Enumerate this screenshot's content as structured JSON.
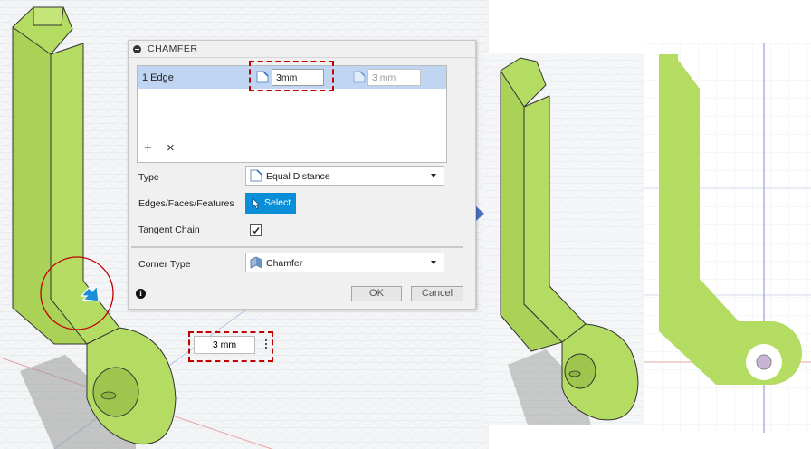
{
  "dialog": {
    "title": "CHAMFER",
    "selection_row": {
      "label": "1 Edge",
      "distance_value": "3mm",
      "second_distance_placeholder": "3 mm"
    },
    "list_add_label": "+",
    "list_remove_label": "×",
    "type_label": "Type",
    "type_value": "Equal Distance",
    "edges_label": "Edges/Faces/Features",
    "select_button": "Select",
    "tangent_chain_label": "Tangent Chain",
    "tangent_chain_checked": true,
    "corner_type_label": "Corner Type",
    "corner_type_value": "Chamfer",
    "info_icon": "i",
    "ok_label": "OK",
    "cancel_label": "Cancel"
  },
  "manipulator_field_value": "3 mm",
  "colors": {
    "part_green": "#b5dc62",
    "part_green_dark": "#9ec64f",
    "selection_blue": "#bfd5f2",
    "select_button": "#0a8ed8",
    "annotation_red": "#c00000",
    "arrow_blue": "#4a74c3"
  },
  "icons": [
    "chamfer-icon",
    "cursor-icon",
    "corner-type-icon",
    "info-icon",
    "right-arrow-icon",
    "manipulator-arrow-icon"
  ]
}
